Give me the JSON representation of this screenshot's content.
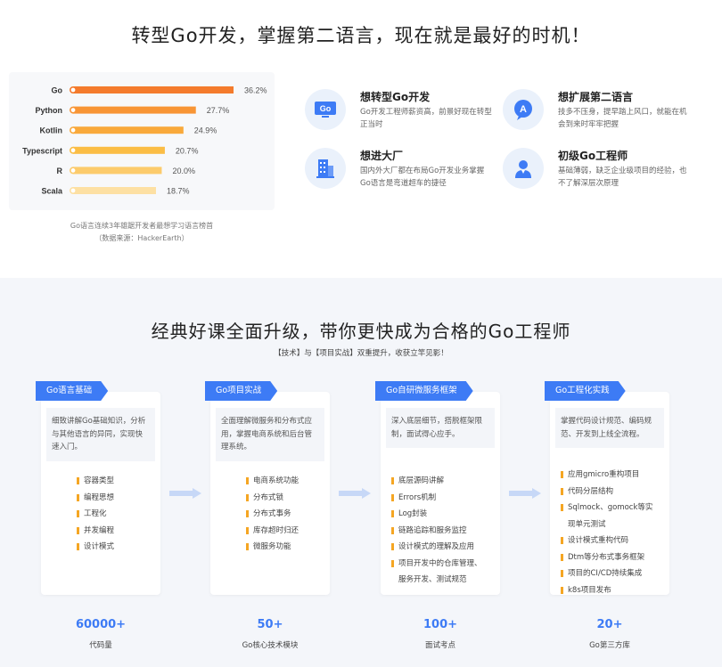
{
  "section1": {
    "title": "转型Go开发，掌握第二语言，现在就是最好的时机！",
    "caption_line1": "Go语言连续3年雄踞开发者最想学习语言榜首",
    "caption_line2": "（数据来源：HackerEarth）"
  },
  "chart_data": {
    "type": "bar",
    "orientation": "horizontal",
    "categories": [
      "Go",
      "Python",
      "Kotlin",
      "Typescript",
      "R",
      "Scala"
    ],
    "values": [
      36.2,
      27.7,
      24.9,
      20.7,
      20.0,
      18.7
    ],
    "value_labels": [
      "36.2%",
      "27.7%",
      "24.9%",
      "20.7%",
      "20.0%",
      "18.7%"
    ],
    "colors": [
      "#f47b2c",
      "#f89535",
      "#f9a93b",
      "#fbbd45",
      "#fccb6c",
      "#fde0a3"
    ],
    "title": "",
    "xlabel": "",
    "ylabel": "",
    "unit": "%",
    "xlim": [
      0,
      40
    ],
    "grid": false
  },
  "features": [
    {
      "title": "想转型Go开发",
      "desc": "Go开发工程师薪资高，前景好现在转型正当时",
      "icon": "go-logo-icon"
    },
    {
      "title": "想扩展第二语言",
      "desc": "技多不压身，提早踏上风口，就能在机会到来时牢牢把握",
      "icon": "language-icon"
    },
    {
      "title": "想进大厂",
      "desc": "国内外大厂都在布局Go开发业务掌握Go语言是弯道超车的捷径",
      "icon": "building-icon"
    },
    {
      "title": "初级Go工程师",
      "desc": "基础薄弱，缺乏企业级项目的经验，也不了解深层次原理",
      "icon": "engineer-icon"
    }
  ],
  "section2": {
    "title": "经典好课全面升级，带你更快成为合格的Go工程师",
    "subtitle": "【技术】与【项目实战】双重提升，收获立竿见影！"
  },
  "courses": [
    {
      "tag": "Go语言基础",
      "intro": "细致讲解Go基础知识，分析与其他语言的异同，实现快速入门。",
      "items": [
        "容器类型",
        "编程思想",
        "工程化",
        "并发编程",
        "设计模式"
      ]
    },
    {
      "tag": "Go项目实战",
      "intro": "全面理解微服务和分布式应用，掌握电商系统和后台管理系统。",
      "items": [
        "电商系统功能",
        "分布式锁",
        "分布式事务",
        "库存超时归还",
        "微服务功能"
      ]
    },
    {
      "tag": "Go自研微服务框架",
      "intro": "深入底层细节，搭脱框架限制，面试得心应手。",
      "items": [
        "底层源码讲解",
        "Errors机制",
        "Log封装",
        "链路追踪和服务监控",
        "设计模式的理解及应用",
        "项目开发中的仓库管理、",
        "服务开发、测试规范"
      ]
    },
    {
      "tag": "Go工程化实践",
      "intro": "掌握代码设计规范、编码规范、开发到上线全流程。",
      "items": [
        "应用gmicro重构项目",
        "代码分层结构",
        "Sqlmock、gomock等实",
        "现单元测试",
        "设计模式重构代码",
        "Dtm等分布式事务框架",
        "项目的CI/CD持续集成",
        "k8s项目发布"
      ]
    }
  ],
  "stats": [
    {
      "value": "60000+",
      "label": "代码量"
    },
    {
      "value": "50+",
      "label": "Go核心技术模块"
    },
    {
      "value": "100+",
      "label": "面试考点"
    },
    {
      "value": "20+",
      "label": "Go第三方库"
    }
  ],
  "accent_color": "#3d7bf5"
}
